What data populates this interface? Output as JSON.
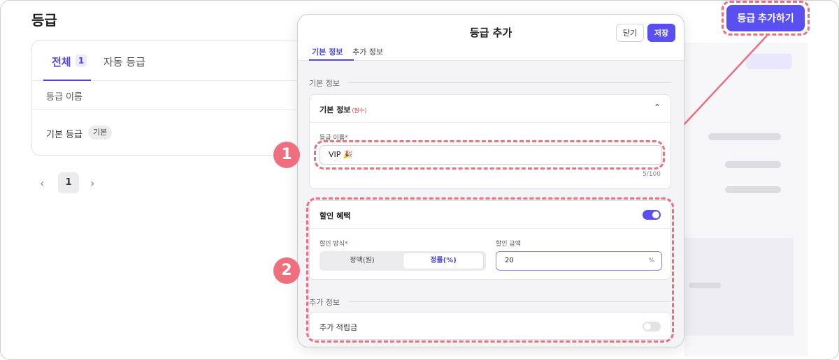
{
  "page": {
    "title": "등급",
    "add_button": "등급 추가하기"
  },
  "list": {
    "tabs": [
      {
        "label": "전체",
        "count": "1"
      },
      {
        "label": "자동 등급"
      }
    ],
    "column_header": "등급 이름",
    "rows": [
      {
        "name": "기본 등급",
        "badge": "기본"
      }
    ],
    "pagination": {
      "current": "1",
      "prev_icon": "chevron-left-icon",
      "next_icon": "chevron-right-icon"
    }
  },
  "modal": {
    "title": "등급 추가",
    "close_label": "닫기",
    "save_label": "저장",
    "tabs": [
      "기본 정보",
      "추가 정보"
    ],
    "section_basic": "기본 정보",
    "basic_card": {
      "title": "기본 정보",
      "required_tag": "(필수)",
      "field_label": "등급 이름",
      "required_mark": "*",
      "field_value": "VIP 🎉",
      "counter": "5/100"
    },
    "discount_card": {
      "title": "할인 혜택",
      "toggle_on": true,
      "method_label": "할인 방식",
      "method_options": [
        "정액(원)",
        "정률(%)"
      ],
      "method_selected": "정률(%)",
      "amount_label": "할인 금액",
      "amount_value": "20",
      "amount_unit": "%"
    },
    "section_extra": "추가 정보",
    "extra_card": {
      "title": "추가 적립금",
      "toggle_on": false
    }
  },
  "annotations": {
    "step1": "1",
    "step2": "2",
    "highlight_color": "#e8707f"
  },
  "colors": {
    "accent": "#5a4ff0",
    "accent_text": "#4f46e5",
    "required": "#e5484d"
  }
}
